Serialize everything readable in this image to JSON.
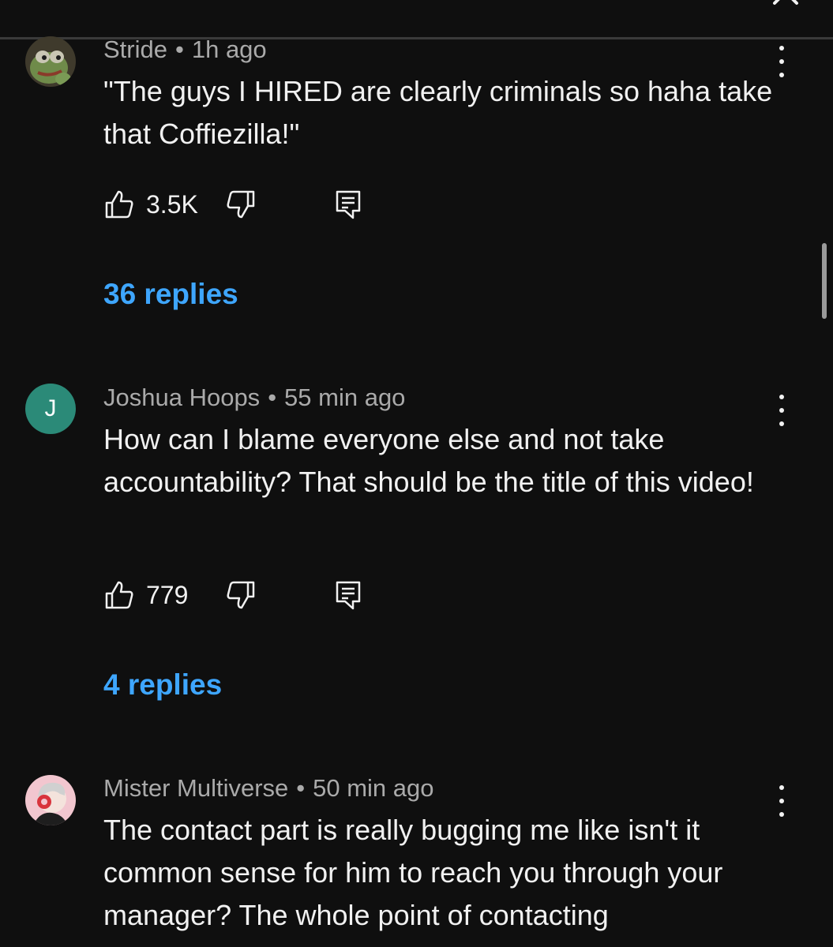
{
  "comments": [
    {
      "author": "Stride",
      "time": "1h ago",
      "avatar": {
        "type": "image",
        "icon": "frog-avatar-icon"
      },
      "text": "\"The guys I HIRED are clearly criminals so haha take that Coffiezilla!\"",
      "likes": "3.5K",
      "replies": "36 replies"
    },
    {
      "author": "Joshua Hoops",
      "time": "55 min ago",
      "avatar": {
        "type": "letter",
        "letter": "J",
        "color": "#2b8a78"
      },
      "text": "How can I blame everyone else and not take accountability? That should be the title of this video!",
      "likes": "779",
      "replies": "4 replies"
    },
    {
      "author": "Mister Multiverse",
      "time": "50 min ago",
      "avatar": {
        "type": "image",
        "icon": "cartoon-person-avatar-icon"
      },
      "text": "The contact part is really bugging me like isn't it common sense for him to reach you through your manager? The whole point of contacting"
    }
  ],
  "colors": {
    "background": "#0f0f0f",
    "text": "#f1f1f1",
    "meta": "#aaaaaa",
    "link": "#3ea6ff"
  }
}
